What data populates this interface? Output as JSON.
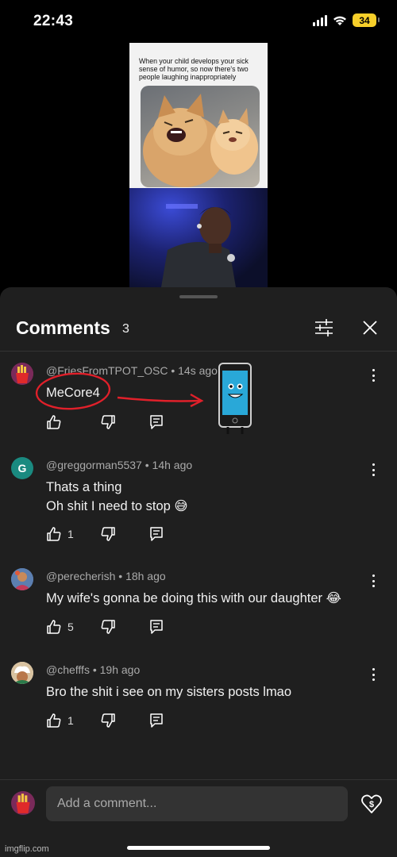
{
  "status_bar": {
    "time": "22:43",
    "battery": "34"
  },
  "video": {
    "meme_caption": "When your child develops your sick sense of humor, so now there's two people laughing inappropriately"
  },
  "comments_panel": {
    "title": "Comments",
    "count": "3",
    "comments": [
      {
        "author": "@FriesFromTPOT_OSC",
        "time": "14s ago",
        "text": "MeCore4",
        "likes": ""
      },
      {
        "author": "@greggorman5537",
        "time": "14h ago",
        "text": "Thats a thing",
        "text2": "Oh shit I need to stop 😅",
        "likes": "1",
        "avatar_letter": "G"
      },
      {
        "author": "@perecherish",
        "time": "18h ago",
        "text": "My wife's gonna be doing this with our daughter 😂",
        "likes": "5"
      },
      {
        "author": "@chefffs",
        "time": "19h ago",
        "text": "Bro the shit i see on my sisters posts lmao",
        "likes": "1"
      }
    ]
  },
  "composer": {
    "placeholder": "Add a comment..."
  },
  "watermark": "imgflip.com",
  "colors": {
    "sheet_bg": "#1f1f1f",
    "annotation_red": "#e0202a",
    "avatar_g": "#1a8a80"
  }
}
